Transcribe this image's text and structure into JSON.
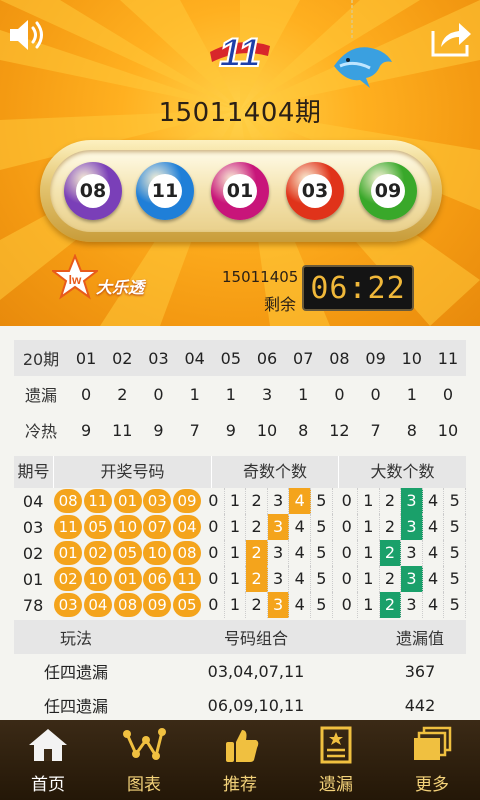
{
  "header": {
    "issue": "15011404期",
    "balls": [
      {
        "number": "08",
        "color": "#7a3fb8"
      },
      {
        "number": "11",
        "color": "#1f7fd8"
      },
      {
        "number": "01",
        "color": "#c8157a"
      },
      {
        "number": "03",
        "color": "#e0331a"
      },
      {
        "number": "09",
        "color": "#39a82a"
      }
    ],
    "lotto_name": "大乐透",
    "next_issue": "15011405",
    "remain_label": "剩余",
    "countdown": "06:22"
  },
  "stats": {
    "header": [
      "20期",
      "01",
      "02",
      "03",
      "04",
      "05",
      "06",
      "07",
      "08",
      "09",
      "10",
      "11"
    ],
    "rows": [
      {
        "label": "遗漏",
        "values": [
          "0",
          "2",
          "0",
          "1",
          "1",
          "3",
          "1",
          "0",
          "0",
          "1",
          "0"
        ]
      },
      {
        "label": "冷热",
        "values": [
          "9",
          "11",
          "9",
          "7",
          "9",
          "10",
          "8",
          "12",
          "7",
          "8",
          "10"
        ]
      }
    ]
  },
  "history": {
    "headers": [
      "期号",
      "开奖号码",
      "奇数个数",
      "大数个数"
    ],
    "scale": [
      "0",
      "1",
      "2",
      "3",
      "4",
      "5"
    ],
    "rows": [
      {
        "issue": "04",
        "balls": [
          "08",
          "11",
          "01",
          "03",
          "09"
        ],
        "odd": 4,
        "big": 3
      },
      {
        "issue": "03",
        "balls": [
          "11",
          "05",
          "10",
          "07",
          "04"
        ],
        "odd": 3,
        "big": 3
      },
      {
        "issue": "02",
        "balls": [
          "01",
          "02",
          "05",
          "10",
          "08"
        ],
        "odd": 2,
        "big": 2
      },
      {
        "issue": "01",
        "balls": [
          "02",
          "10",
          "01",
          "06",
          "11"
        ],
        "odd": 2,
        "big": 3
      },
      {
        "issue": "78",
        "balls": [
          "03",
          "04",
          "08",
          "09",
          "05"
        ],
        "odd": 3,
        "big": 2
      }
    ]
  },
  "combos": {
    "headers": [
      "玩法",
      "号码组合",
      "遗漏值"
    ],
    "rows": [
      {
        "play": "任四遗漏",
        "combo": "03,04,07,11",
        "miss": "367"
      },
      {
        "play": "任四遗漏",
        "combo": "06,09,10,11",
        "miss": "442"
      }
    ]
  },
  "nav": [
    {
      "label": "首页",
      "icon": "home-icon"
    },
    {
      "label": "图表",
      "icon": "chart-icon"
    },
    {
      "label": "推荐",
      "icon": "thumbs-up-icon"
    },
    {
      "label": "遗漏",
      "icon": "document-icon"
    },
    {
      "label": "更多",
      "icon": "more-icon"
    }
  ]
}
